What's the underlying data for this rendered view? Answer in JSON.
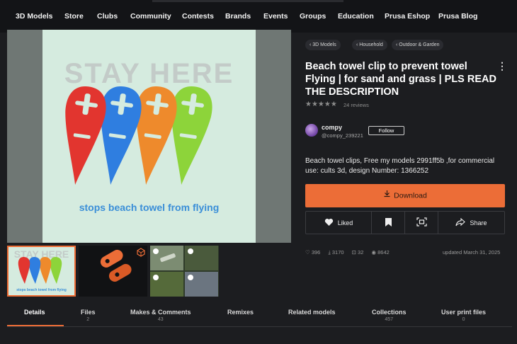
{
  "nav": {
    "items": [
      "3D Models",
      "Store",
      "Clubs",
      "Community",
      "Contests",
      "Brands",
      "Events",
      "Groups",
      "Education",
      "Prusa Eshop",
      "Prusa Blog"
    ]
  },
  "gallery": {
    "main_text": "STAY HERE",
    "caption": "stops beach towel from flying",
    "thumb_text": "STAY HERE",
    "thumb_caption": "stops beach towel from flying",
    "clip_colors": [
      "#e2352f",
      "#2f7ee0",
      "#ee8a2c",
      "#8dd43a"
    ]
  },
  "breadcrumbs": [
    "3D Models",
    "Household",
    "Outdoor & Garden"
  ],
  "model": {
    "title": "Beach towel clip to prevent towel Flying | for sand and grass | PLS READ THE DESCRIPTION",
    "rating": 4.5,
    "stars": "★★★★★",
    "reviews": "24 reviews",
    "description": "Beach towel clips, Free my models 2991ff5b ,for commercial use: cults 3d, design Number: 1366252"
  },
  "author": {
    "name": "compy",
    "handle": "@compy_239221",
    "follow_label": "Follow"
  },
  "actions": {
    "download_label": "Download",
    "liked_label": "Liked",
    "share_label": "Share"
  },
  "stats": {
    "likes": "396",
    "downloads": "3170",
    "prints": "32",
    "views": "8642",
    "updated": "updated March 31, 2025"
  },
  "tabs": [
    {
      "label": "Details",
      "count": ""
    },
    {
      "label": "Files",
      "count": "2"
    },
    {
      "label": "Makes & Comments",
      "count": "43"
    },
    {
      "label": "Remixes",
      "count": ""
    },
    {
      "label": "Related models",
      "count": ""
    },
    {
      "label": "Collections",
      "count": "457"
    },
    {
      "label": "User print files",
      "count": "0"
    }
  ],
  "colors": {
    "accent": "#ec6d37",
    "background": "#1c1d20",
    "nav_background": "#131417"
  }
}
